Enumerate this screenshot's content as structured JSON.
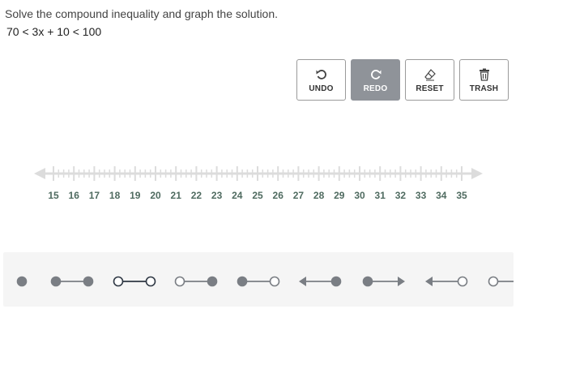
{
  "question": {
    "prompt": "Solve the compound inequality and graph the solution.",
    "equation": "70 < 3x + 10 < 100"
  },
  "toolbar": {
    "undo_label": "UNDO",
    "redo_label": "REDO",
    "reset_label": "RESET",
    "trash_label": "TRASH"
  },
  "numberline": {
    "min": 15,
    "max": 35,
    "tick_labels": [
      "15",
      "16",
      "17",
      "18",
      "19",
      "20",
      "21",
      "22",
      "23",
      "24",
      "25",
      "26",
      "27",
      "28",
      "29",
      "30",
      "31",
      "32",
      "33",
      "34",
      "35"
    ]
  },
  "palette": {
    "tools": [
      "point-closed",
      "segment-closed-closed",
      "segment-open-open",
      "segment-open-closed",
      "segment-closed-open",
      "ray-left-closed",
      "ray-right-closed",
      "ray-left-open",
      "ray-right-open"
    ]
  },
  "colors": {
    "gray_tool": "#7a7e84",
    "active_tool": "#2f3844",
    "axis": "#dcdcdc",
    "tick_label": "#4f6b60"
  }
}
